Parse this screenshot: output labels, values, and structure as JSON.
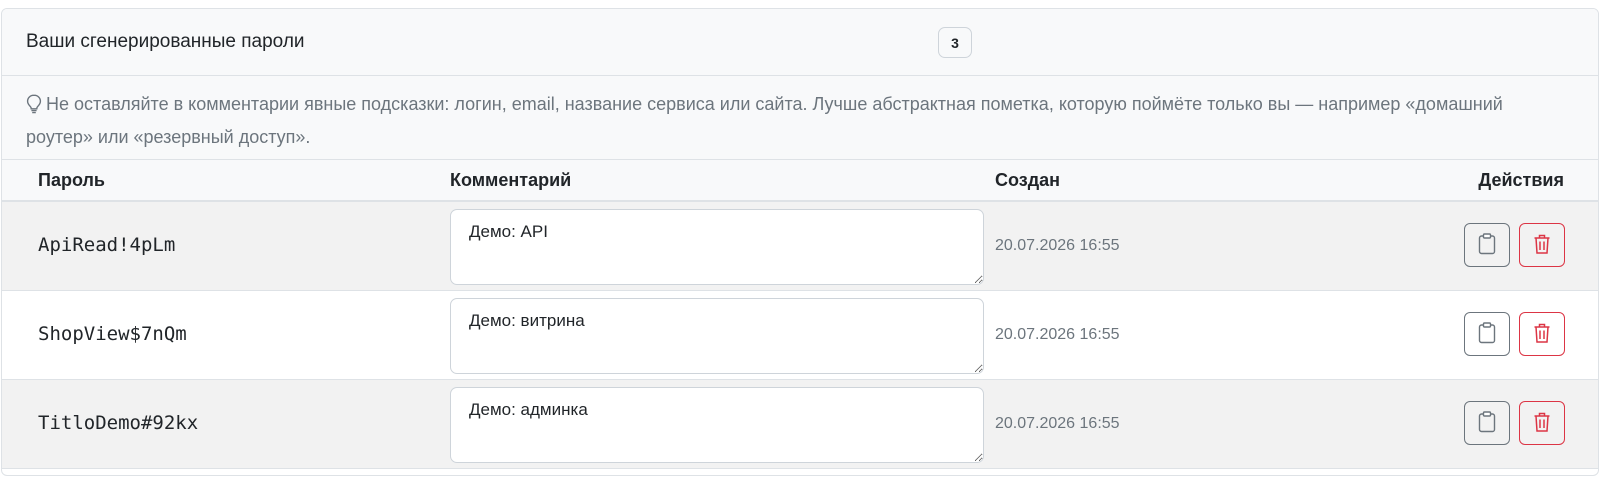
{
  "header": {
    "title": "Ваши сгенерированные пароли",
    "count": "3"
  },
  "hint": {
    "icon": "lightbulb-icon",
    "text": "Не оставляйте в комментарии явные подсказки: логин, email, название сервиса или сайта. Лучше абстрактная пометка, которую поймёте только вы — например «домашний роутер» или «резервный доступ»."
  },
  "table": {
    "columns": {
      "password": "Пароль",
      "comment": "Комментарий",
      "created": "Создан",
      "actions": "Действия"
    },
    "rows": [
      {
        "password": "ApiRead!4pLm",
        "comment": "Демо: API",
        "created": "20.07.2026 16:55"
      },
      {
        "password": "ShopView$7nQm",
        "comment": "Демо: витрина",
        "created": "20.07.2026 16:55"
      },
      {
        "password": "TitloDemo#92kx",
        "comment": "Демо: админка",
        "created": "20.07.2026 16:55"
      }
    ]
  },
  "colors": {
    "danger": "#dc3545",
    "secondary": "#6c757d",
    "header_bg": "#f8f9fa"
  },
  "icons": {
    "copy": "clipboard-icon",
    "delete": "trash-icon"
  }
}
